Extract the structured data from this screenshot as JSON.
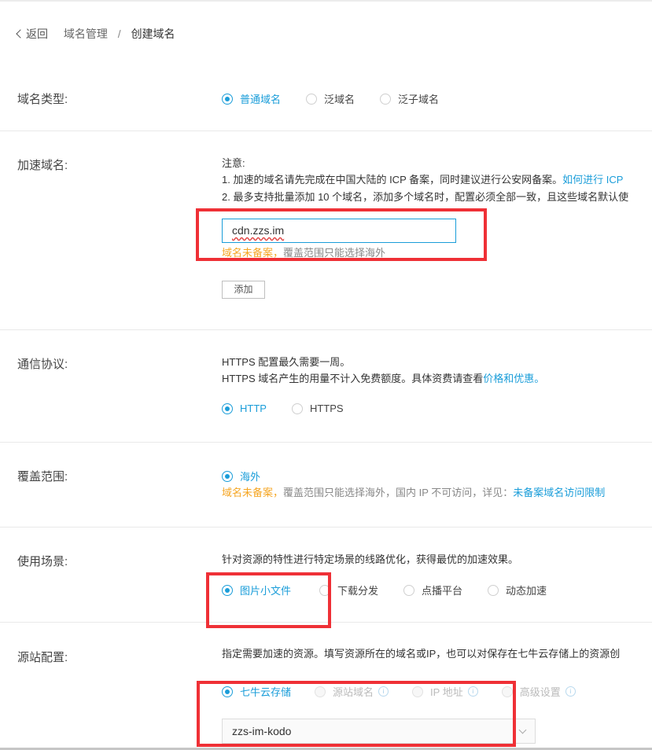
{
  "breadcrumb": {
    "back": "返回",
    "parent": "域名管理",
    "separator": "/",
    "current": "创建域名"
  },
  "domain_type": {
    "label": "域名类型:",
    "options": [
      {
        "label": "普通域名",
        "selected": true
      },
      {
        "label": "泛域名",
        "selected": false
      },
      {
        "label": "泛子域名",
        "selected": false
      }
    ]
  },
  "accel_domain": {
    "label": "加速域名:",
    "note_title": "注意:",
    "note1": "1. 加速的域名请先完成在中国大陆的 ICP 备案，同时建议进行公安网备案。",
    "note1_link": "如何进行 ICP",
    "note2": "2. 最多支持批量添加 10 个域名，添加多个域名时，配置必须全部一致，且这些域名默认使",
    "input_value": "cdn.zzs.im",
    "warn_orange": "域名未备案，",
    "warn_text": "覆盖范围只能选择海外",
    "add_button": "添加"
  },
  "protocol": {
    "label": "通信协议:",
    "line1": "HTTPS 配置最久需要一周。",
    "line2": "HTTPS 域名产生的用量不计入免费额度。具体资费请查看",
    "line2_link": "价格和优惠。",
    "options": [
      {
        "label": "HTTP",
        "selected": true
      },
      {
        "label": "HTTPS",
        "selected": false
      }
    ]
  },
  "coverage": {
    "label": "覆盖范围:",
    "option": "海外",
    "warn_orange": "域名未备案，",
    "warn_text": "覆盖范围只能选择海外，国内 IP 不可访问，详见：",
    "warn_link": "未备案域名访问限制"
  },
  "scenario": {
    "label": "使用场景:",
    "desc": "针对资源的特性进行特定场景的线路优化，获得最优的加速效果。",
    "options": [
      {
        "label": "图片小文件",
        "selected": true
      },
      {
        "label": "下载分发",
        "selected": false
      },
      {
        "label": "点播平台",
        "selected": false
      },
      {
        "label": "动态加速",
        "selected": false
      }
    ]
  },
  "origin": {
    "label": "源站配置:",
    "desc": "指定需要加速的资源。填写资源所在的域名或IP，也可以对保存在七牛云存储上的资源创",
    "options": [
      {
        "label": "七牛云存储",
        "selected": true
      },
      {
        "label": "源站域名",
        "selected": false
      },
      {
        "label": "IP 地址",
        "selected": false
      },
      {
        "label": "高级设置",
        "selected": false
      }
    ],
    "info_glyph": "i",
    "bucket_value": "zzs-im-kodo"
  },
  "colors": {
    "accent": "#1a9dd9",
    "warning": "#f5a623",
    "highlight_box": "#ef3036"
  }
}
